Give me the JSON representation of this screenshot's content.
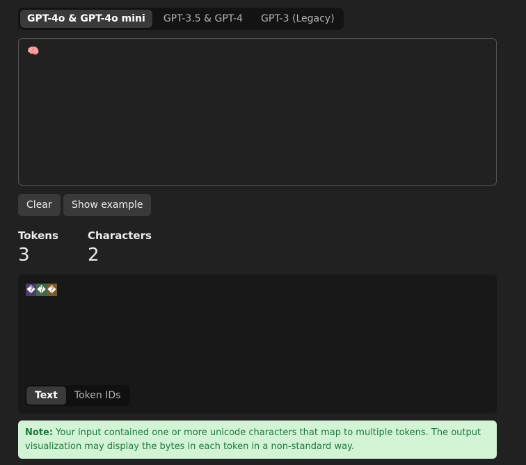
{
  "model_tabs": [
    {
      "label": "GPT-4o & GPT-4o mini",
      "active": true
    },
    {
      "label": "GPT-3.5 & GPT-4",
      "active": false
    },
    {
      "label": "GPT-3 (Legacy)",
      "active": false
    }
  ],
  "input": {
    "value": "🧠"
  },
  "buttons": {
    "clear": "Clear",
    "show_example": "Show example"
  },
  "stats": {
    "tokens_label": "Tokens",
    "tokens_value": "3",
    "characters_label": "Characters",
    "characters_value": "2"
  },
  "output": {
    "tokens": [
      {
        "text": "�",
        "color": "#4b3b6e"
      },
      {
        "text": "�",
        "color": "#3f6b4a"
      },
      {
        "text": "�",
        "color": "#7a5a2a"
      }
    ],
    "view_tabs": [
      {
        "label": "Text",
        "active": true
      },
      {
        "label": "Token IDs",
        "active": false
      }
    ]
  },
  "note": {
    "label": "Note:",
    "text": " Your input contained one or more unicode characters that map to multiple tokens. The output visualization may display the bytes in each token in a non-standard way."
  }
}
